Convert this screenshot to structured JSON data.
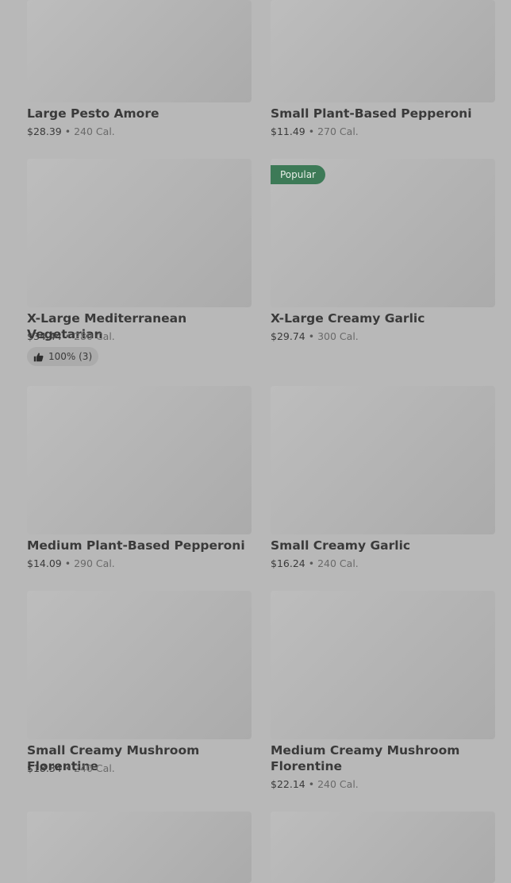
{
  "colors": {
    "background": "#b8b8b8",
    "card_image": "#b0b0b0",
    "badge": "#3d7a57",
    "text_primary": "#3a3a3a",
    "text_secondary": "#6a6a6a"
  },
  "menu_items": [
    {
      "name": "Large Pesto Amore",
      "price": "$28.39",
      "separator": "•",
      "calories": "240 Cal."
    },
    {
      "name": "Small Plant-Based Pepperoni",
      "price": "$11.49",
      "separator": "•",
      "calories": "270 Cal."
    },
    {
      "name": "X-Large Mediterranean Vegetarian",
      "price": "$34.44",
      "separator": "•",
      "calories": "280 Cal.",
      "rating": "100% (3)",
      "rating_icon": "thumbs-up-icon"
    },
    {
      "name": "X-Large Creamy Garlic",
      "price": "$29.74",
      "separator": "•",
      "calories": "300 Cal.",
      "badge": "Popular"
    },
    {
      "name": "Medium Plant-Based Pepperoni",
      "price": "$14.09",
      "separator": "•",
      "calories": "290 Cal."
    },
    {
      "name": "Small Creamy Garlic",
      "price": "$16.24",
      "separator": "•",
      "calories": "240 Cal."
    },
    {
      "name": "Small Creamy Mushroom Florentine",
      "price": "$18.34",
      "separator": "•",
      "calories": "240 Cal."
    },
    {
      "name": "Medium Creamy Mushroom Florentine",
      "price": "$22.14",
      "separator": "•",
      "calories": "240 Cal."
    }
  ]
}
